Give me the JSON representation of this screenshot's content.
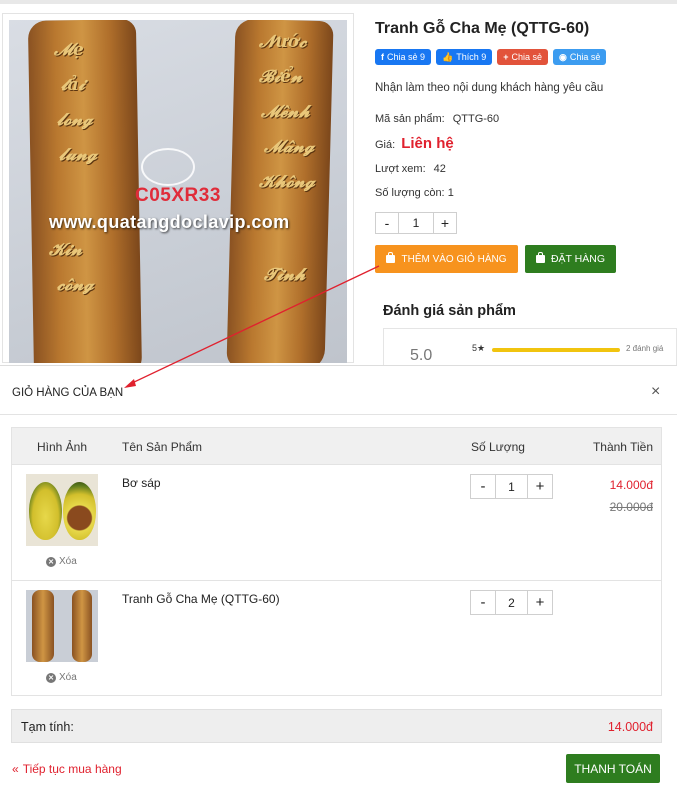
{
  "product": {
    "title": "Tranh Gỗ Cha Mẹ (QTTG-60)",
    "share_buttons": [
      {
        "label": "Chia sẻ 9",
        "icon": "facebook-icon",
        "color": "#1877f2"
      },
      {
        "label": "Thích 9",
        "icon": "like-icon",
        "color": "#1877f2"
      },
      {
        "label": "Chia sẻ",
        "icon": "google-plus-icon",
        "color": "#e2533b"
      },
      {
        "label": "Chia sẻ",
        "icon": "zalo-icon",
        "color": "#3c9cf0"
      }
    ],
    "description": "Nhận làm theo nội dung khách hàng yêu cầu",
    "code_label": "Mã sản phẩm:",
    "code_value": "QTTG-60",
    "price_label": "Giá:",
    "price_value": "Liên hệ",
    "views_label": "Lượt xem:",
    "views_value": "42",
    "stock_label": "Số lượng còn:",
    "stock_value": "1",
    "qty": {
      "minus": "-",
      "value": "1",
      "plus": "+"
    },
    "add_to_cart_label": "THÊM VÀO GIỎ HÀNG",
    "order_label": "ĐẶT HÀNG",
    "image_watermark_code": "C05XR33",
    "image_watermark_site": "www.quatangdoclavip.com"
  },
  "reviews": {
    "title": "Đánh giá sản phẩm",
    "score": "5.0",
    "star_label": "5★",
    "star_fill": 1.0,
    "star_count": "2 đánh giá"
  },
  "cart": {
    "title": "GIỎ HÀNG CỦA BẠN",
    "close_symbol": "×",
    "columns": [
      "Hình Ảnh",
      "Tên Sản Phẩm",
      "Số Lượng",
      "Thành Tiền"
    ],
    "remove_label": "Xóa",
    "items": [
      {
        "name": "Bơ sáp",
        "qty": "1",
        "price": "14.000đ",
        "old_price": "20.000đ",
        "thumb": "avocado-image"
      },
      {
        "name": "Tranh Gỗ Cha Mẹ (QTTG-60)",
        "qty": "2",
        "price": "",
        "old_price": "",
        "thumb": "wood-painting-image"
      }
    ],
    "qty_minus": "-",
    "qty_plus": "+",
    "subtotal_label": "Tạm tính:",
    "subtotal_value": "14.000đ",
    "continue_label": "Tiếp tục mua hàng",
    "checkout_label": "THANH TOÁN"
  },
  "colors": {
    "accent_red": "#e0212e",
    "orange": "#f7931e",
    "green": "#2e7d1f",
    "facebook": "#1877f2"
  }
}
